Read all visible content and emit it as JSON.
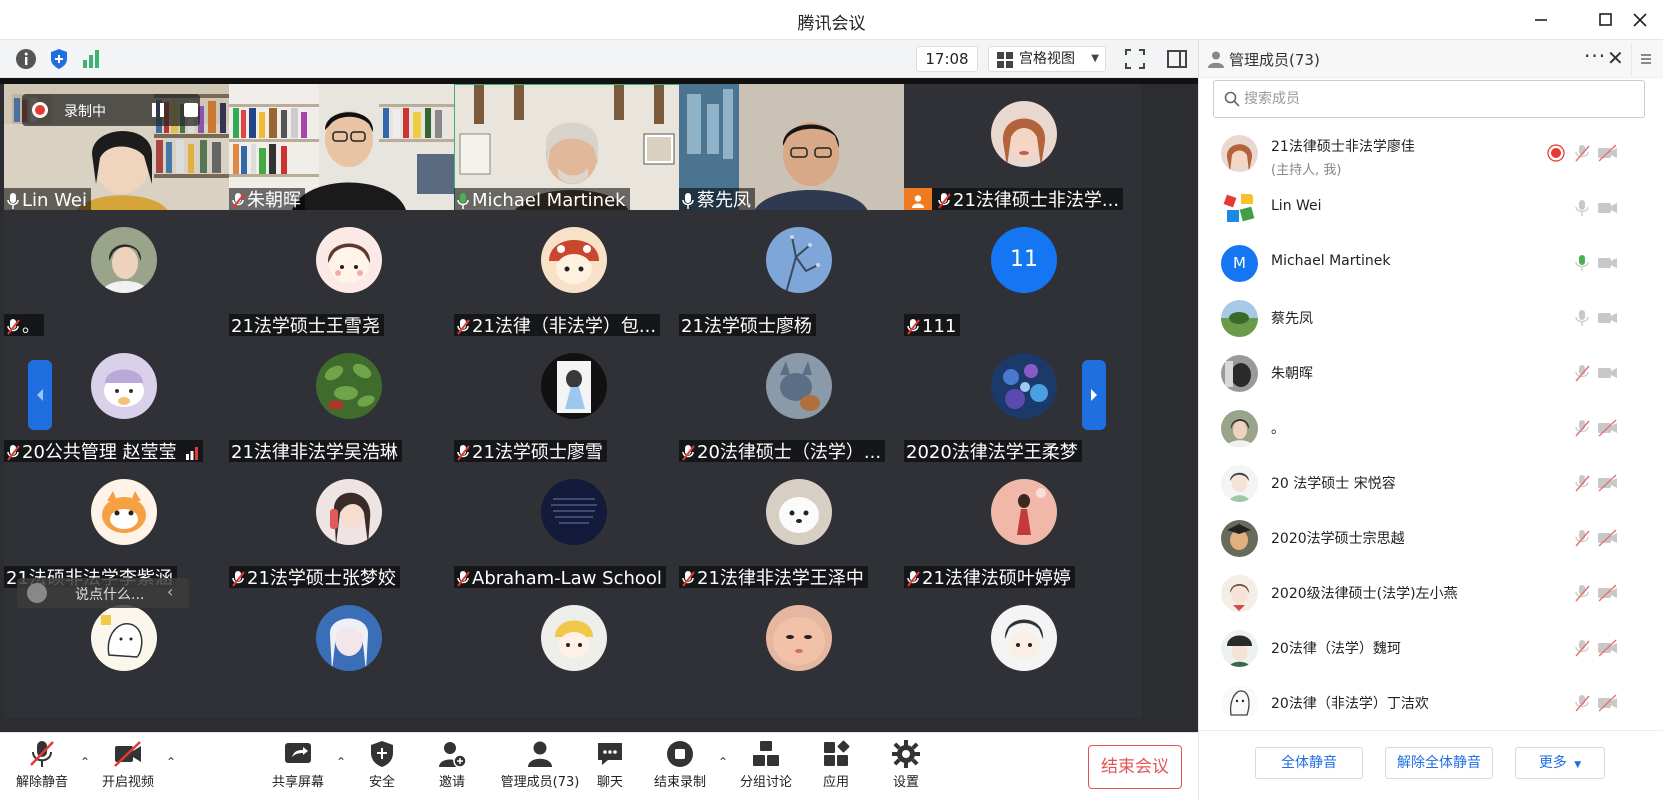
{
  "window": {
    "title": "腾讯会议"
  },
  "topbar": {
    "clock": "17:08",
    "view_label": "宫格视图",
    "icons": [
      "info-icon",
      "shield-icon",
      "signal-icon",
      "fullscreen-icon",
      "sidebar-toggle-icon"
    ]
  },
  "recording": {
    "label": "录制中"
  },
  "tiles": [
    {
      "name": "Lin Wei",
      "mic": "on"
    },
    {
      "name": "朱朝晖",
      "mic": "muted"
    },
    {
      "name": "Michael Martinek",
      "mic": "speaking"
    },
    {
      "name": "蔡先凤",
      "mic": "on"
    },
    {
      "name": "21法律硕士非法学...",
      "mic": "muted",
      "host": true
    },
    {
      "name": "。",
      "mic": "muted"
    },
    {
      "name": "21法学硕士王雪尧",
      "mic": "none"
    },
    {
      "name": "21法律（非法学）包...",
      "mic": "muted"
    },
    {
      "name": "21法学硕士廖杨",
      "mic": "none"
    },
    {
      "name": "111",
      "mic": "muted",
      "avatar_text": "11"
    },
    {
      "name": "20公共管理 赵莹莹",
      "mic": "muted"
    },
    {
      "name": "21法律非法学吴浩琳",
      "mic": "none"
    },
    {
      "name": "21法学硕士廖雪",
      "mic": "muted"
    },
    {
      "name": "20法律硕士（法学）...",
      "mic": "muted"
    },
    {
      "name": "2020法律法学王柔梦",
      "mic": "none"
    },
    {
      "name": "21法硕非法学李紫涵",
      "mic": "none"
    },
    {
      "name": "21法学硕士张梦姣",
      "mic": "muted"
    },
    {
      "name": "Abraham-Law School",
      "mic": "muted"
    },
    {
      "name": "21法律非法学王泽中",
      "mic": "muted"
    },
    {
      "name": "21法律法硕叶婷婷",
      "mic": "muted"
    }
  ],
  "chat": {
    "placeholder": "说点什么..."
  },
  "controls": {
    "unmute": "解除静音",
    "start_video": "开启视频",
    "share": "共享屏幕",
    "security": "安全",
    "invite": "邀请",
    "manage": "管理成员(73)",
    "chat": "聊天",
    "stop_record": "结束录制",
    "breakout": "分组讨论",
    "apps": "应用",
    "settings": "设置",
    "end_meeting": "结束会议"
  },
  "panel": {
    "title": "管理成员(73)",
    "search_placeholder": "搜索成员",
    "members": [
      {
        "name": "21法律硕士非法学廖佳",
        "sub": "(主持人, 我)",
        "rec": true,
        "mic": "muted",
        "cam": "off"
      },
      {
        "name": "Lin Wei",
        "mic": "on",
        "cam": "on"
      },
      {
        "name": "Michael Martinek",
        "avatar_letter": "M",
        "mic": "speaking",
        "cam": "on"
      },
      {
        "name": "蔡先凤",
        "mic": "on",
        "cam": "on"
      },
      {
        "name": "朱朝晖",
        "mic": "muted",
        "cam": "on"
      },
      {
        "name": "。",
        "mic": "muted",
        "cam": "off"
      },
      {
        "name": "20 法学硕士 宋悦容",
        "mic": "muted",
        "cam": "off"
      },
      {
        "name": "2020法学硕士宗思越",
        "mic": "muted",
        "cam": "off"
      },
      {
        "name": "2020级法律硕士(法学)左小燕",
        "mic": "muted",
        "cam": "off"
      },
      {
        "name": "20法律（法学）魏珂",
        "mic": "muted",
        "cam": "off"
      },
      {
        "name": "20法律（非法学）丁洁欢",
        "mic": "muted",
        "cam": "off"
      }
    ],
    "mute_all": "全体静音",
    "unmute_all": "解除全体静音",
    "more": "更多"
  },
  "colors": {
    "accent": "#1f6fe0",
    "danger": "#e35454",
    "stage_bg": "#2b2d31",
    "speaking": "#4caf50"
  }
}
